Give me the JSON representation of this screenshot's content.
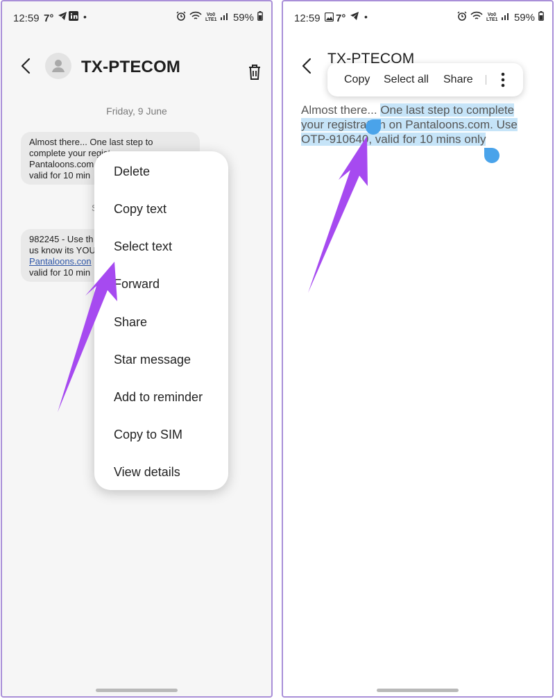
{
  "left": {
    "status": {
      "time": "12:59",
      "temp": "7°",
      "network": "Vo0 LTE1",
      "battery": "59%"
    },
    "header": {
      "title": "TX-PTECOM"
    },
    "date": "Friday, 9 June",
    "messages": [
      {
        "text": "Almost there... One last step to complete your registr",
        "line3": "Pantaloons.com",
        "line4": "valid for 10 min"
      },
      {
        "line1": "982245 - Use th",
        "line2": "us know its YOU",
        "link": "Pantaloons.con",
        "line4": "valid for 10 min"
      }
    ],
    "partial_ts": [
      "n",
      "n"
    ],
    "partial_s": "S",
    "menu": [
      "Delete",
      "Copy text",
      "Select text",
      "Forward",
      "Share",
      "Star message",
      "Add to reminder",
      "Copy to SIM",
      "View details"
    ]
  },
  "right": {
    "status": {
      "time": "12:59",
      "temp": "7°",
      "network": "Vo0 LTE1",
      "battery": "59%"
    },
    "header": {
      "title": "TX-PTECOM"
    },
    "toolbar": {
      "copy": "Copy",
      "select_all": "Select all",
      "share": "Share"
    },
    "message": {
      "prefix": "Almost there... ",
      "selected": "One last step to complete your registration on Pantaloons.com. Use OTP-910640, valid for 10 mins only"
    }
  },
  "colors": {
    "arrow": "#a64af0",
    "selection": "#c6e4f8",
    "handle": "#4aa3ea",
    "frame": "#a98fd8"
  }
}
